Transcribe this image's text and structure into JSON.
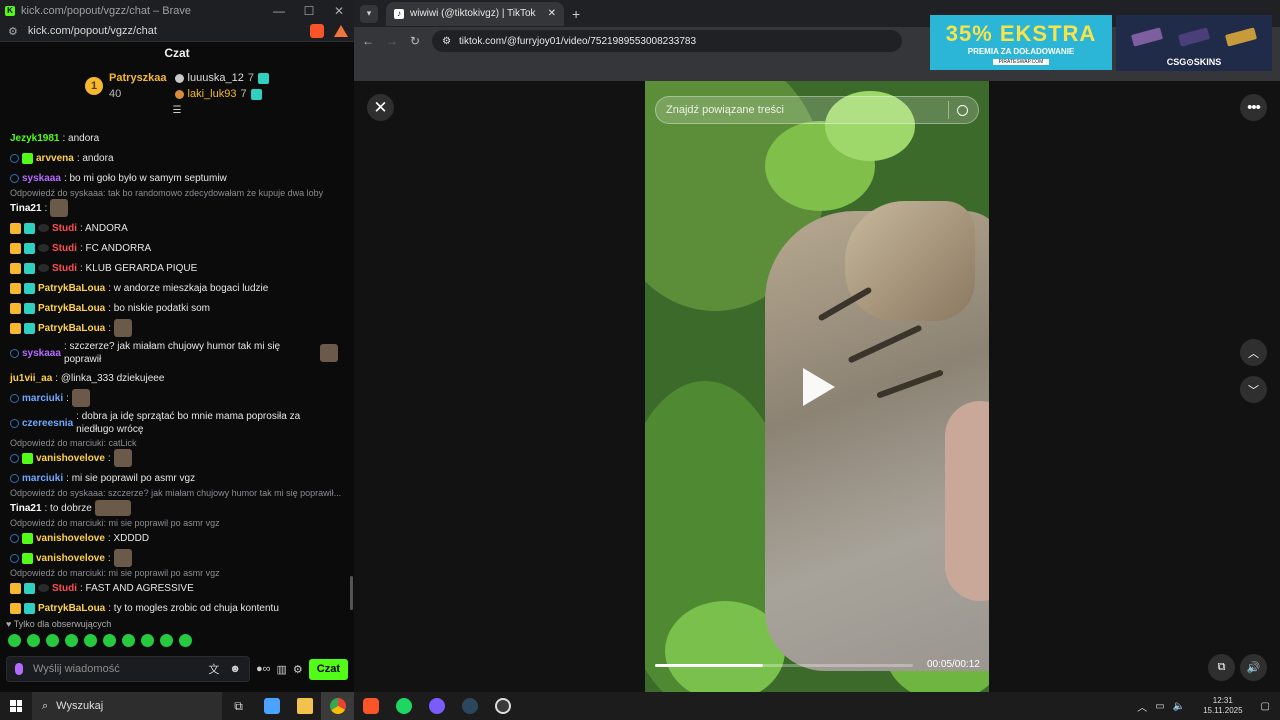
{
  "kick": {
    "window_title": "kick.com/popout/vgzz/chat – Brave",
    "url": "kick.com/popout/vgzz/chat",
    "chat_title": "Czat",
    "leaderboard": {
      "first": {
        "rank": "1",
        "name": "Patryszkaa",
        "count": "40"
      },
      "others": [
        {
          "name": "luuuska_12",
          "count": "7"
        },
        {
          "name": "laki_luk93",
          "count": "7"
        }
      ]
    },
    "messages": [
      {
        "user": "Jezyk1981",
        "text": ": andora",
        "color": "#53fc18"
      },
      {
        "user": "arvvena",
        "text": ": andora",
        "color": "#ffd24a"
      },
      {
        "user": "syskaaa",
        "text": ": bo mi goło było w samym septumiw",
        "color": "#b46cff"
      },
      {
        "reply": "Odpowiedź do syskaaa: tak bo randomowo zdecydowałam że kupuje dwa loby"
      },
      {
        "user": "Tina21",
        "text": ":",
        "color": "#ffffff"
      },
      {
        "user": "Studi",
        "text": ": ANDORA",
        "color": "#ff4d4d"
      },
      {
        "user": "Studi",
        "text": ": FC ANDORRA",
        "color": "#ff4d4d"
      },
      {
        "user": "Studi",
        "text": ": KLUB GERARDA PIQUE",
        "color": "#ff4d4d"
      },
      {
        "user": "PatrykBaLoua",
        "text": ": w andorze mieszkaja bogaci ludzie",
        "color": "#ffd24a"
      },
      {
        "user": "PatrykBaLoua",
        "text": ": bo niskie podatki som",
        "color": "#ffd24a"
      },
      {
        "user": "PatrykBaLoua",
        "text": ":",
        "color": "#ffd24a"
      },
      {
        "user": "syskaaa",
        "text": ": szczerze? jak miałam chujowy humor tak mi się poprawił",
        "color": "#b46cff"
      },
      {
        "user": "ju1vii_aa",
        "text": ": @linka_333 dziekujeee",
        "color": "#ffd24a"
      },
      {
        "user": "marciuki",
        "text": ":",
        "color": "#6ea8ff"
      },
      {
        "user": "czereesnia",
        "text": ": dobra ja idę sprzątać bo mnie mama poprosiła za niedługo wrócę",
        "color": "#6ea8ff"
      },
      {
        "reply": "Odpowiedź do marciuki: catLick"
      },
      {
        "user": "vanishovelove",
        "text": ":",
        "color": "#ffd24a"
      },
      {
        "user": "marciuki",
        "text": ": mi sie poprawil po asmr vgz",
        "color": "#6ea8ff"
      },
      {
        "reply": "Odpowiedź do syskaaa: szczerze? jak miałam chujowy humor tak mi się poprawił..."
      },
      {
        "user": "Tina21",
        "text": ": to dobrze",
        "color": "#ffffff"
      },
      {
        "reply": "Odpowiedź do marciuki: mi sie poprawil po asmr vgz"
      },
      {
        "user": "vanishovelove",
        "text": ": XDDDD",
        "color": "#ffd24a"
      },
      {
        "user": "vanishovelove",
        "text": ":",
        "color": "#ffd24a"
      },
      {
        "reply": "Odpowiedź do marciuki: mi sie poprawil po asmr vgz"
      },
      {
        "user": "Studi",
        "text": ": FAST AND AGRESSIVE",
        "color": "#ff4d4d"
      },
      {
        "user": "PatrykBaLoua",
        "text": ": ty to mogles zrobic od chuja kontentu",
        "color": "#ffd24a"
      }
    ],
    "followers_only": "Tylko dla obserwujących",
    "input_placeholder": "Wyślij wiadomość",
    "send_label": "Czat"
  },
  "browser": {
    "tab_title": "wiwiwi (@tiktokivgz) | TikTok",
    "url": "tiktok.com/@furryjoy01/video/7521989553008233783",
    "ads": {
      "ad1_big": "35% EKSTRA",
      "ad1_mid": "PREMIA ZA DOŁADOWANIE",
      "ad1_tiny": "PIRATESWAP.COM",
      "ad2_logo": "CSG⊙SKINS"
    }
  },
  "tiktok": {
    "search_placeholder": "Znajdź powiązane treści",
    "time": "00:05/00:12",
    "progress": 0.42
  },
  "taskbar": {
    "search_label": "Wyszukaj",
    "time": "12:31",
    "date": "15.11.2025"
  }
}
